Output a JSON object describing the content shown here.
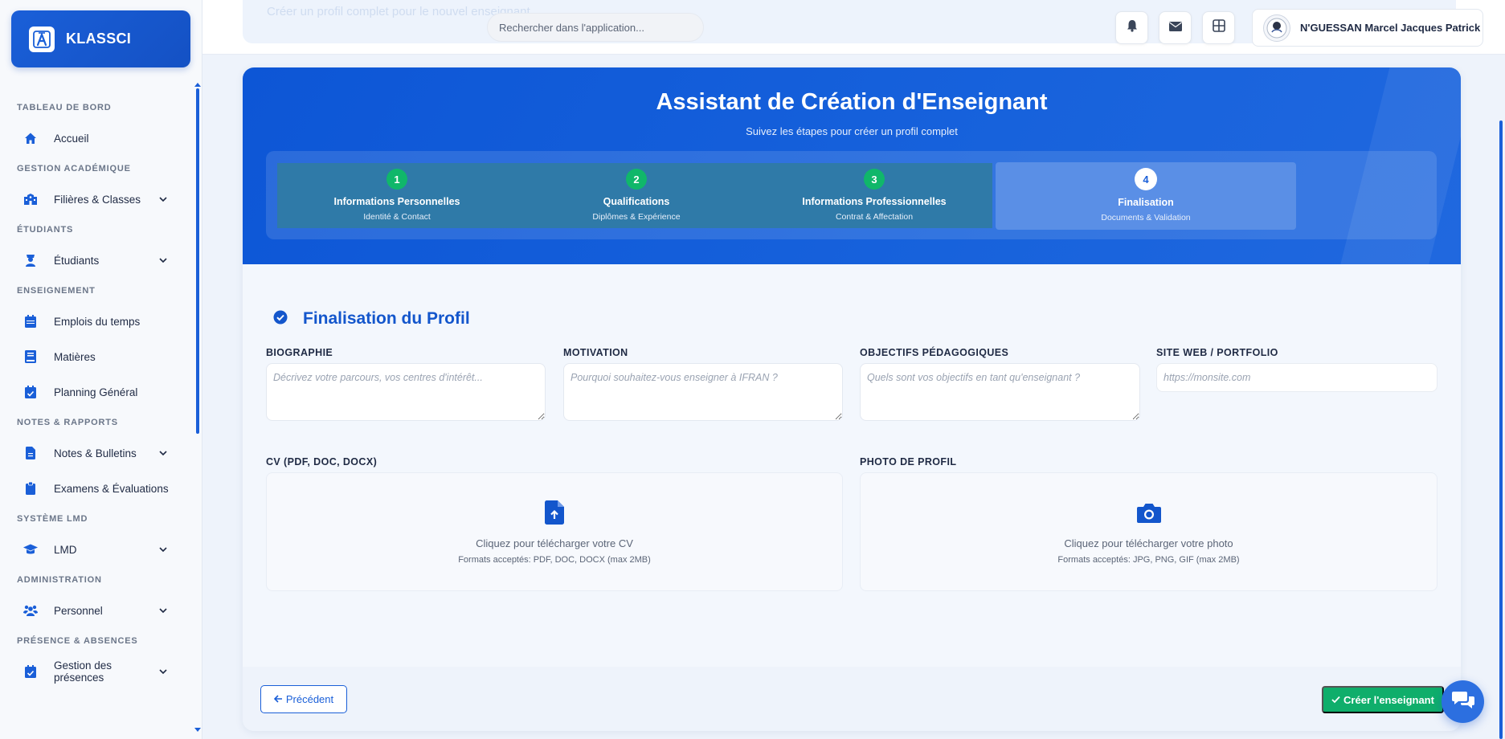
{
  "brand": {
    "name": "KLASSCI"
  },
  "sidebar": {
    "sections": [
      {
        "title": "TABLEAU DE BORD",
        "items": [
          {
            "label": "Accueil",
            "icon": "home-icon",
            "expandable": false
          }
        ]
      },
      {
        "title": "GESTION ACADÉMIQUE",
        "items": [
          {
            "label": "Filières & Classes",
            "icon": "school-icon",
            "expandable": true
          }
        ]
      },
      {
        "title": "ÉTUDIANTS",
        "items": [
          {
            "label": "Étudiants",
            "icon": "student-icon",
            "expandable": true
          }
        ]
      },
      {
        "title": "ENSEIGNEMENT",
        "items": [
          {
            "label": "Emplois du temps",
            "icon": "calendar-icon",
            "expandable": false
          },
          {
            "label": "Matières",
            "icon": "book-icon",
            "expandable": false
          },
          {
            "label": "Planning Général",
            "icon": "calendar-check-icon",
            "expandable": false
          }
        ]
      },
      {
        "title": "NOTES & RAPPORTS",
        "items": [
          {
            "label": "Notes & Bulletins",
            "icon": "file-icon",
            "expandable": true
          },
          {
            "label": "Examens & Évaluations",
            "icon": "clipboard-icon",
            "expandable": false
          }
        ]
      },
      {
        "title": "SYSTÈME LMD",
        "items": [
          {
            "label": "LMD",
            "icon": "graduation-cap-icon",
            "expandable": true
          }
        ]
      },
      {
        "title": "ADMINISTRATION",
        "items": [
          {
            "label": "Personnel",
            "icon": "users-icon",
            "expandable": true
          }
        ]
      },
      {
        "title": "PRÉSENCE & ABSENCES",
        "items": [
          {
            "label": "Gestion des présences",
            "icon": "calendar-check-icon",
            "expandable": true
          }
        ]
      }
    ]
  },
  "topbar": {
    "ghost_text": "Créer un profil complet pour le nouvel enseignant",
    "search_placeholder": "Rechercher dans l'application...",
    "user_name": "N'GUESSAN Marcel Jacques Patrick"
  },
  "wizard": {
    "title": "Assistant de Création d'Enseignant",
    "subtitle": "Suivez les étapes pour créer un profil complet",
    "steps": [
      {
        "number": "1",
        "title": "Informations Personnelles",
        "subtitle": "Identité & Contact",
        "state": "done"
      },
      {
        "number": "2",
        "title": "Qualifications",
        "subtitle": "Diplômes & Expérience",
        "state": "done"
      },
      {
        "number": "3",
        "title": "Informations Professionnelles",
        "subtitle": "Contrat & Affectation",
        "state": "done"
      },
      {
        "number": "4",
        "title": "Finalisation",
        "subtitle": "Documents & Validation",
        "state": "active"
      }
    ]
  },
  "form": {
    "section_title": "Finalisation du Profil",
    "biographie": {
      "label": "BIOGRAPHIE",
      "placeholder": "Décrivez votre parcours, vos centres d'intérêt...",
      "value": ""
    },
    "motivation": {
      "label": "MOTIVATION",
      "placeholder": "Pourquoi souhaitez-vous enseigner à IFRAN ?",
      "value": ""
    },
    "objectifs": {
      "label": "OBJECTIFS PÉDAGOGIQUES",
      "placeholder": "Quels sont vos objectifs en tant qu'enseignant ?",
      "value": ""
    },
    "site_web": {
      "label": "SITE WEB / PORTFOLIO",
      "placeholder": "https://monsite.com",
      "value": ""
    },
    "cv": {
      "label": "CV (PDF, DOC, DOCX)",
      "text": "Cliquez pour télécharger votre CV",
      "formats": "Formats acceptés: PDF, DOC, DOCX (max 2MB)"
    },
    "photo": {
      "label": "PHOTO DE PROFIL",
      "text": "Cliquez pour télécharger votre photo",
      "formats": "Formats acceptés: JPG, PNG, GIF (max 2MB)"
    }
  },
  "actions": {
    "previous_label": "Précédent",
    "create_label": "Créer l'enseignant"
  },
  "colors": {
    "primary": "#1a5fd8",
    "success": "#0fae6b",
    "step_bg": "#2f7aa8",
    "step_active_bg": "#5a8fe6"
  }
}
